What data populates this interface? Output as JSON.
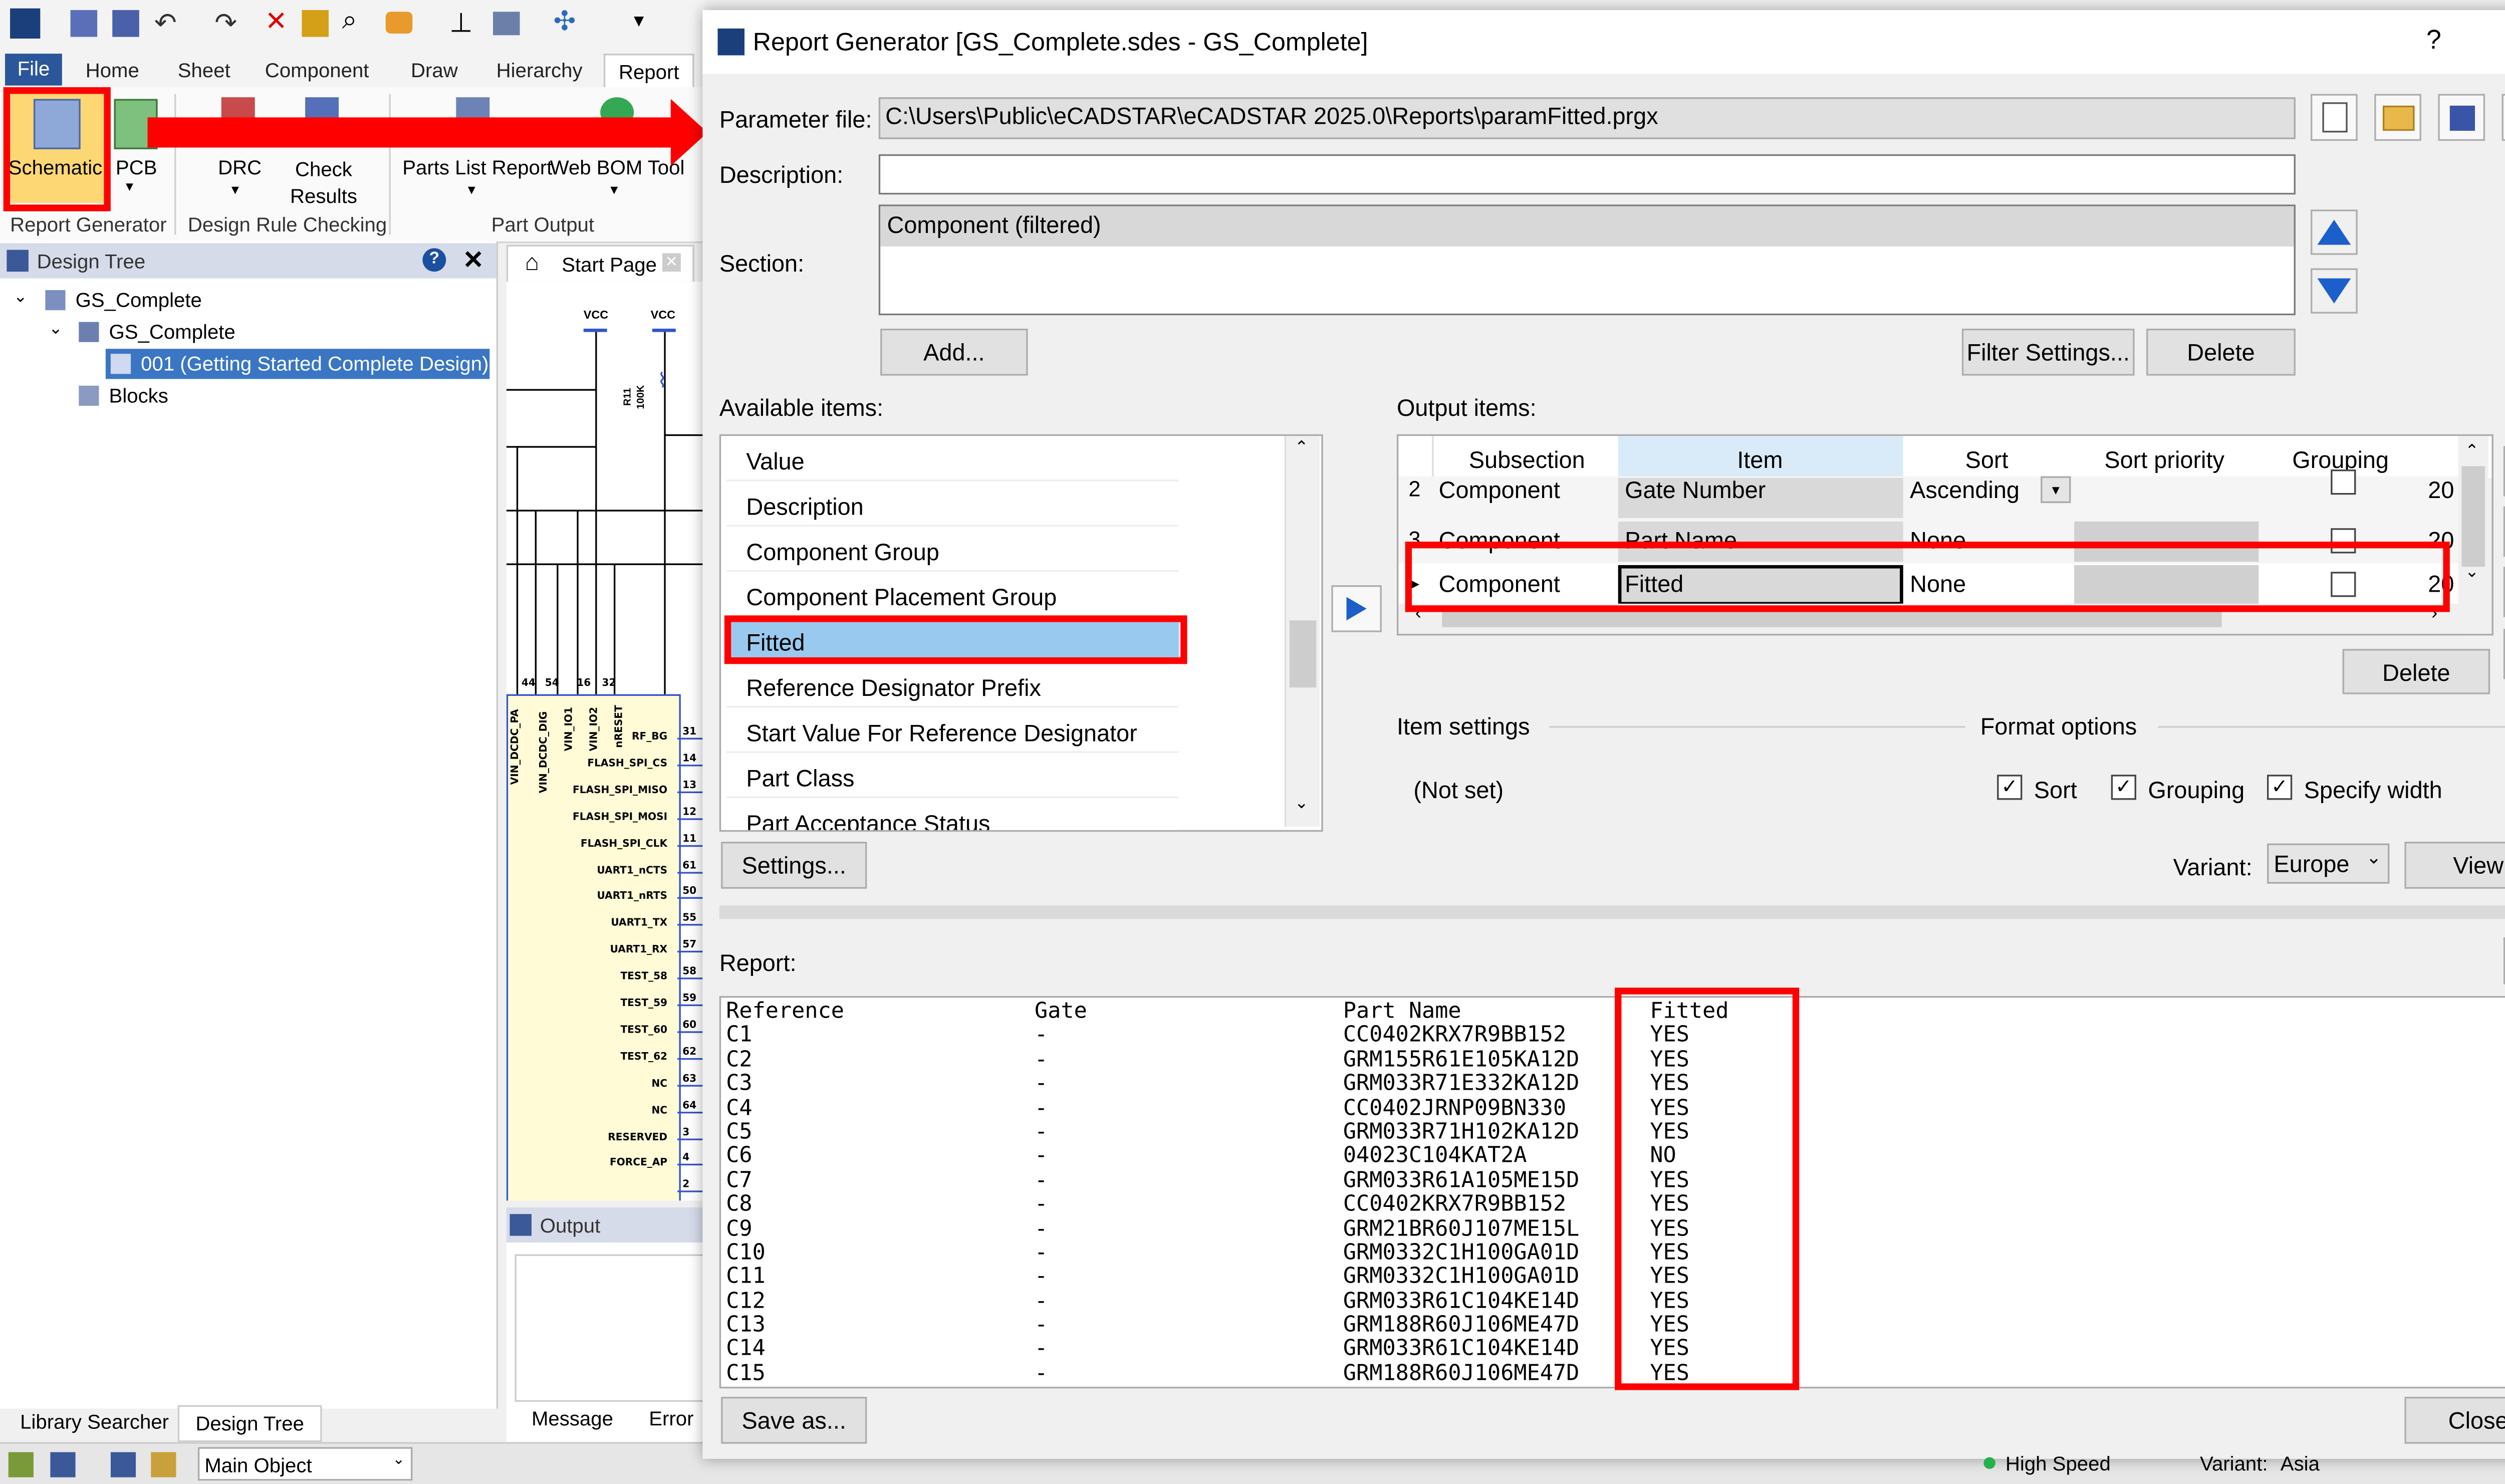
{
  "app": {
    "ribbon_tabs": [
      "File",
      "Home",
      "Sheet",
      "Component",
      "Draw",
      "Hierarchy",
      "Report"
    ],
    "ribbon_buttons": {
      "schematic": "Schematic",
      "pcb": "PCB",
      "drc": "DRC",
      "check_results": "Check Results",
      "parts_list": "Parts List Report",
      "web_bom": "Web BOM Tool"
    },
    "ribbon_groups": [
      "Report Generator",
      "Design Rule Checking",
      "Part Output"
    ],
    "design_tree": {
      "title": "Design Tree",
      "items": [
        "GS_Complete",
        "GS_Complete",
        "001 (Getting Started Complete Design)",
        "Blocks"
      ]
    },
    "start_page_tab": "Start Page",
    "schematic": {
      "vcc": "VCC",
      "resistor": "R11",
      "resistor_value": "100K",
      "top_pins": [
        "44",
        "54",
        "16",
        "32"
      ],
      "side_text": [
        "VIN_DCDC_PA",
        "VIN_DCDC_DIG",
        "VIN_IO1",
        "VIN_IO2",
        "nRESET"
      ],
      "pins": [
        {
          "name": "RF_BG",
          "num": "31"
        },
        {
          "name": "FLASH_SPI_CS",
          "num": "14"
        },
        {
          "name": "FLASH_SPI_MISO",
          "num": "13"
        },
        {
          "name": "FLASH_SPI_MOSI",
          "num": "12"
        },
        {
          "name": "FLASH_SPI_CLK",
          "num": "11"
        },
        {
          "name": "UART1_nCTS",
          "num": "61"
        },
        {
          "name": "UART1_nRTS",
          "num": "50"
        },
        {
          "name": "UART1_TX",
          "num": "55"
        },
        {
          "name": "UART1_RX",
          "num": "57"
        },
        {
          "name": "TEST_58",
          "num": "58"
        },
        {
          "name": "TEST_59",
          "num": "59"
        },
        {
          "name": "TEST_60",
          "num": "60"
        },
        {
          "name": "TEST_62",
          "num": "62"
        },
        {
          "name": "NC",
          "num": "63"
        },
        {
          "name": "NC",
          "num": "64"
        },
        {
          "name": "RESERVED",
          "num": "3"
        },
        {
          "name": "FORCE_AP",
          "num": "4"
        },
        {
          "name": "",
          "num": "2"
        }
      ]
    },
    "output_panel": {
      "title": "Output",
      "tabs": [
        "Message",
        "Error"
      ]
    },
    "bottom_tabs": [
      "Library Searcher",
      "Design Tree"
    ],
    "status": {
      "main_object": "Main Object",
      "high_speed": "High Speed",
      "variant": "Variant:",
      "variant_value": "Asia"
    }
  },
  "dialog": {
    "title": "Report Generator [GS_Complete.sdes - GS_Complete]",
    "help": "?",
    "close_x": "✕",
    "parameter_file_label": "Parameter file:",
    "parameter_file": "C:\\Users\\Public\\eCADSTAR\\eCADSTAR 2025.0\\Reports\\paramFitted.prgx",
    "description_label": "Description:",
    "description": "",
    "section_label": "Section:",
    "section_items": [
      "Component (filtered)"
    ],
    "add_button": "Add...",
    "filter_button": "Filter Settings...",
    "delete_section_button": "Delete",
    "available_label": "Available items:",
    "available_items": [
      "Value",
      "Description",
      "Component Group",
      "Component Placement Group",
      "Fitted",
      "Reference Designator Prefix",
      "Start Value For Reference Designator",
      "Part Class",
      "Part Acceptance Status"
    ],
    "selected_available": "Fitted",
    "output_label": "Output items:",
    "output_columns": [
      "Subsection",
      "Item",
      "Sort",
      "Sort priority",
      "Grouping"
    ],
    "output_rows": [
      {
        "idx": "2",
        "subsection": "Component",
        "item": "Gate Number",
        "sort": "Ascending",
        "width": "20"
      },
      {
        "idx": "3",
        "subsection": "Component",
        "item": "Part Name",
        "sort": "None",
        "width": "20"
      },
      {
        "idx": "",
        "subsection": "Component",
        "item": "Fitted",
        "sort": "None",
        "width": "20"
      }
    ],
    "delete_output_button": "Delete",
    "settings_button": "Settings...",
    "item_settings_label": "Item settings",
    "item_settings_value": "(Not set)",
    "format_options_label": "Format options",
    "format_options": [
      {
        "label": "Sort",
        "checked": true
      },
      {
        "label": "Grouping",
        "checked": true
      },
      {
        "label": "Specify width",
        "checked": true
      }
    ],
    "variant_label": "Variant:",
    "variant_value": "Europe",
    "view_button": "View",
    "report_label": "Report:",
    "report_headers": [
      "Reference",
      "Gate",
      "Part Name",
      "Fitted"
    ],
    "report_rows": [
      [
        "C1",
        "-",
        "CC0402KRX7R9BB152",
        "YES"
      ],
      [
        "C2",
        "-",
        "GRM155R61E105KA12D",
        "YES"
      ],
      [
        "C3",
        "-",
        "GRM033R71E332KA12D",
        "YES"
      ],
      [
        "C4",
        "-",
        "CC0402JRNP09BN330",
        "YES"
      ],
      [
        "C5",
        "-",
        "GRM033R71H102KA12D",
        "YES"
      ],
      [
        "C6",
        "-",
        "04023C104KAT2A",
        "NO"
      ],
      [
        "C7",
        "-",
        "GRM033R61A105ME15D",
        "YES"
      ],
      [
        "C8",
        "-",
        "CC0402KRX7R9BB152",
        "YES"
      ],
      [
        "C9",
        "-",
        "GRM21BR60J107ME15L",
        "YES"
      ],
      [
        "C10",
        "-",
        "GRM0332C1H100GA01D",
        "YES"
      ],
      [
        "C11",
        "-",
        "GRM0332C1H100GA01D",
        "YES"
      ],
      [
        "C12",
        "-",
        "GRM033R61C104KE14D",
        "YES"
      ],
      [
        "C13",
        "-",
        "GRM188R60J106ME47D",
        "YES"
      ],
      [
        "C14",
        "-",
        "GRM033R61C104KE14D",
        "YES"
      ],
      [
        "C15",
        "-",
        "GRM188R60J106ME47D",
        "YES"
      ]
    ],
    "save_as_button": "Save as...",
    "close_button": "Close"
  },
  "colors": {
    "highlight_red": "#ff0000",
    "selection_blue": "#99c9ef",
    "ribbon_blue": "#2b579a",
    "tree_selected": "#3a76c4",
    "arrow_blue": "#1c5fcb",
    "schematic_fill": "#fffbd6"
  }
}
